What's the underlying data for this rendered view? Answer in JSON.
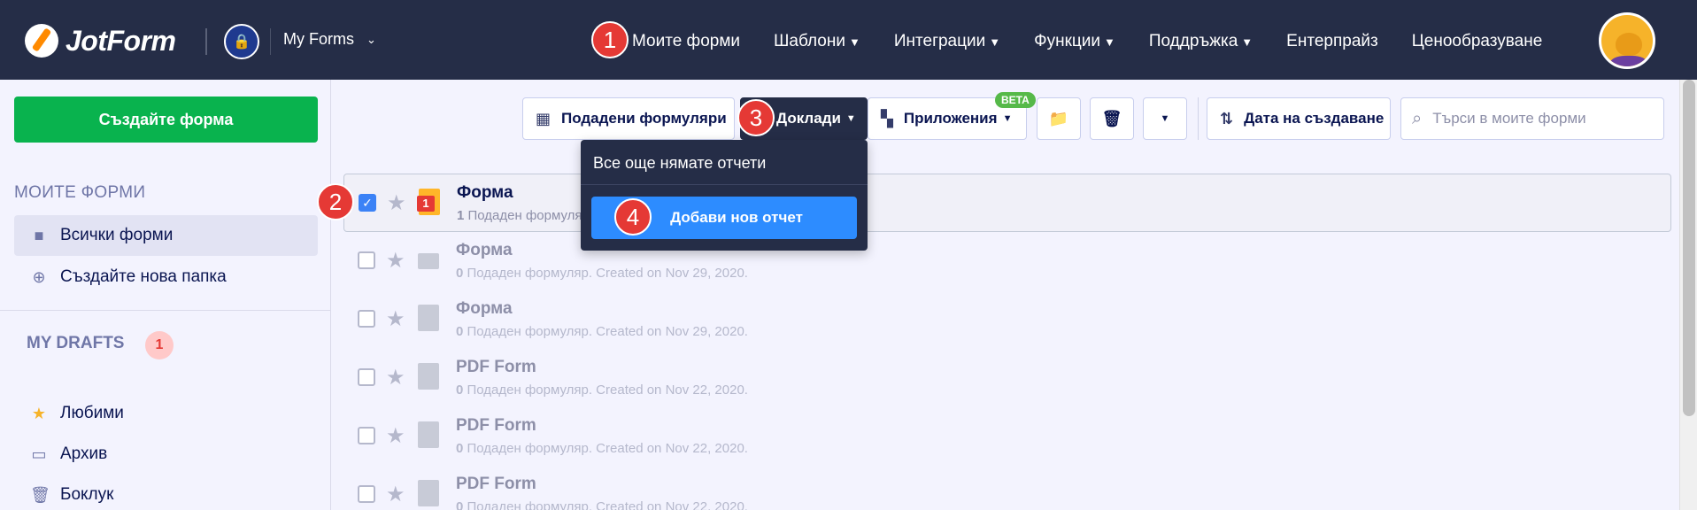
{
  "header": {
    "logo_text": "JotForm",
    "workspace": "My Forms",
    "nav": [
      {
        "label": "Моите форми",
        "caret": false
      },
      {
        "label": "Шаблони",
        "caret": true
      },
      {
        "label": "Интеграции",
        "caret": true
      },
      {
        "label": "Функции",
        "caret": true
      },
      {
        "label": "Поддръжка",
        "caret": true
      },
      {
        "label": "Ентерпрайз",
        "caret": false
      },
      {
        "label": "Ценообразуване",
        "caret": false
      }
    ]
  },
  "sidebar": {
    "create_label": "Създайте форма",
    "section_title": "МОИТЕ ФОРМИ",
    "all_forms": "Всички форми",
    "new_folder": "Създайте нова папка",
    "drafts_title": "MY DRAFTS",
    "drafts_count": "1",
    "favorites": "Любими",
    "archive": "Архив",
    "trash": "Боклук"
  },
  "toolbar": {
    "submissions": "Подадени формуляри",
    "reports": "Доклади",
    "apps": "Приложения",
    "beta": "BETA",
    "sort": "Дата на създаване",
    "search_placeholder": "Търси в моите форми"
  },
  "dropdown": {
    "empty_text": "Все още нямате отчети",
    "add_label": "Добави нов отчет"
  },
  "forms": [
    {
      "title": "Форма",
      "count": "1",
      "meta": "Подаден формуляр. Created on Nov 29, 2020.",
      "selected": true,
      "icon": "orange"
    },
    {
      "title": "Форма",
      "count": "0",
      "meta": "Подаден формуляр. Created on Nov 29, 2020.",
      "selected": false,
      "icon": "flat"
    },
    {
      "title": "Форма",
      "count": "0",
      "meta": "Подаден формуляр. Created on Nov 29, 2020.",
      "selected": false,
      "icon": "doc"
    },
    {
      "title": "PDF Form",
      "count": "0",
      "meta": "Подаден формуляр. Created on Nov 22, 2020.",
      "selected": false,
      "icon": "doc"
    },
    {
      "title": "PDF Form",
      "count": "0",
      "meta": "Подаден формуляр. Created on Nov 22, 2020.",
      "selected": false,
      "icon": "doc"
    },
    {
      "title": "PDF Form",
      "count": "0",
      "meta": "Подаден формуляр. Created on Nov 22, 2020.",
      "selected": false,
      "icon": "doc"
    }
  ],
  "annotations": [
    "1",
    "2",
    "3",
    "4"
  ],
  "colors": {
    "header_bg": "#252d47",
    "create_green": "#09b34e",
    "accent_blue": "#2d8cff",
    "annotation_red": "#e53935"
  }
}
